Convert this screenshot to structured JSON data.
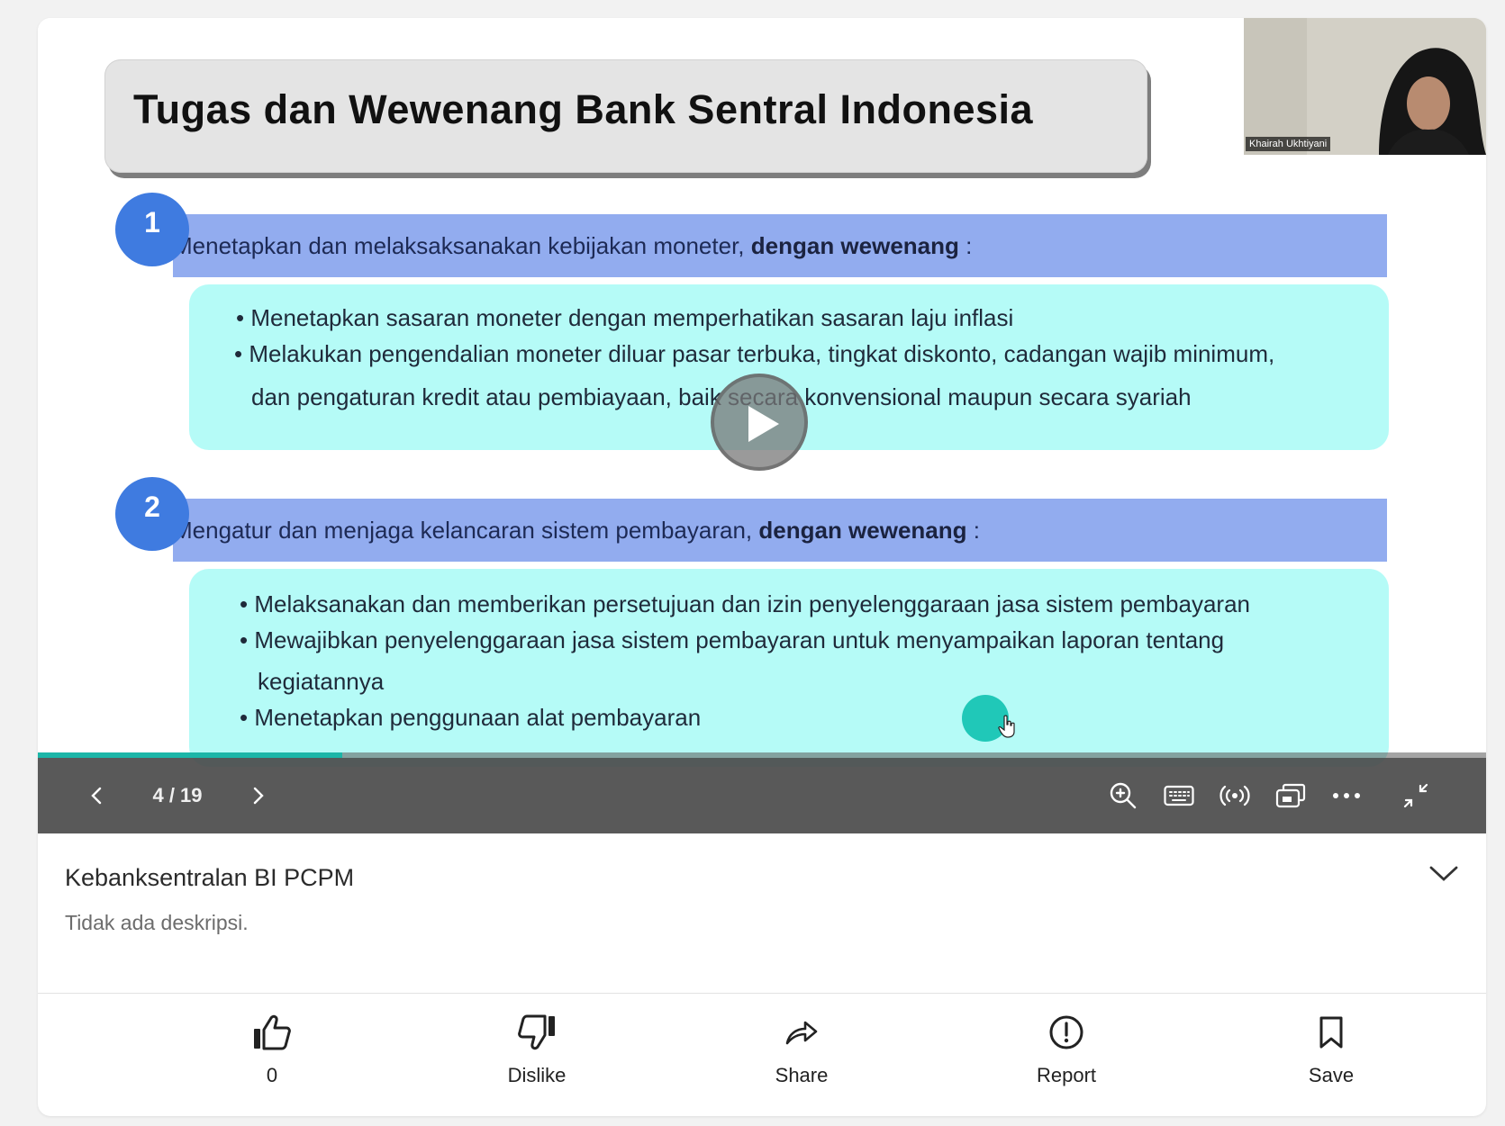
{
  "slide": {
    "title": "Tugas dan Wewenang Bank Sentral Indonesia",
    "sections": [
      {
        "number": "1",
        "heading_plain": "Menetapkan dan melaksaksanakan kebijakan moneter, ",
        "heading_bold": "dengan wewenang",
        "heading_suffix": " :",
        "bullets": [
          "• Menetapkan sasaran moneter dengan memperhatikan sasaran laju inflasi",
          "• Melakukan pengendalian moneter diluar pasar terbuka, tingkat diskonto, cadangan wajib minimum,",
          "dan pengaturan kredit atau pembiayaan, baik secara konvensional maupun secara syariah"
        ]
      },
      {
        "number": "2",
        "heading_plain": "Mengatur dan menjaga kelancaran sistem pembayaran, ",
        "heading_bold": "dengan wewenang",
        "heading_suffix": " :",
        "bullets": [
          "• Melaksanakan dan memberikan persetujuan dan izin penyelenggaraan jasa sistem pembayaran",
          "• Mewajibkan penyelenggaraan jasa sistem pembayaran untuk menyampaikan laporan tentang",
          "kegiatannya",
          "• Menetapkan penggunaan alat pembayaran"
        ]
      }
    ]
  },
  "webcam": {
    "name": "Khairah Ukhtiyani"
  },
  "player": {
    "page_indicator": "4 / 19",
    "progress": 0.21,
    "icons": {
      "prev": "chevron-left-icon",
      "next": "chevron-right-icon",
      "zoom": "zoom-in-icon",
      "captions": "keyboard-icon",
      "live": "broadcast-icon",
      "pip": "picture-in-picture-icon",
      "more": "more-icon",
      "exit_fullscreen": "minimize-icon",
      "play": "play-icon"
    },
    "colors": {
      "progress": "#1cb6a8",
      "controls_bg": "#4b4b4b"
    }
  },
  "info": {
    "title": "Kebanksentralan BI PCPM",
    "description": "Tidak ada deskripsi."
  },
  "actions": [
    {
      "label": "0",
      "icon": "thumbs-up-icon"
    },
    {
      "label": "Dislike",
      "icon": "thumbs-down-icon"
    },
    {
      "label": "Share",
      "icon": "share-icon"
    },
    {
      "label": "Report",
      "icon": "report-icon"
    },
    {
      "label": "Save",
      "icon": "bookmark-icon"
    }
  ]
}
